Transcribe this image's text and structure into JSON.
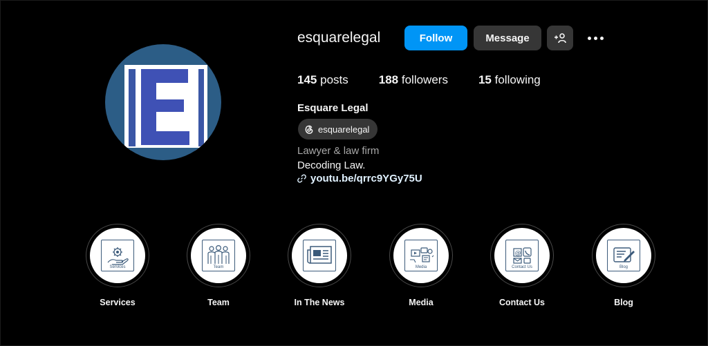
{
  "profile": {
    "username": "esquarelegal",
    "full_name": "Esquare Legal",
    "threads_handle": "esquarelegal",
    "category": "Lawyer & law firm",
    "bio": "Decoding Law.",
    "link": "youtu.be/qrrc9YGy75U",
    "logo_letter": "E"
  },
  "actions": {
    "follow_label": "Follow",
    "message_label": "Message",
    "add_user_icon": "person-plus-icon",
    "more_icon": "more-horizontal-icon"
  },
  "stats": {
    "posts": {
      "count": "145",
      "label": "posts"
    },
    "followers": {
      "count": "188",
      "label": "followers"
    },
    "following": {
      "count": "15",
      "label": "following"
    }
  },
  "highlights": [
    {
      "label": "Services",
      "inner": "Services",
      "icon": "hand-gear-icon"
    },
    {
      "label": "Team",
      "inner": "Team",
      "icon": "team-icon"
    },
    {
      "label": "In The News",
      "inner": "",
      "icon": "newspaper-icon"
    },
    {
      "label": "Media",
      "inner": "Media",
      "icon": "media-icon"
    },
    {
      "label": "Contact Us",
      "inner": "Contact Us",
      "icon": "contact-icon"
    },
    {
      "label": "Blog",
      "inner": "Blog",
      "icon": "blog-icon"
    }
  ],
  "colors": {
    "follow_blue": "#0095f6",
    "button_gray": "#363636",
    "avatar_blue": "#2c5d86",
    "logo_indigo": "#3f51b5"
  }
}
